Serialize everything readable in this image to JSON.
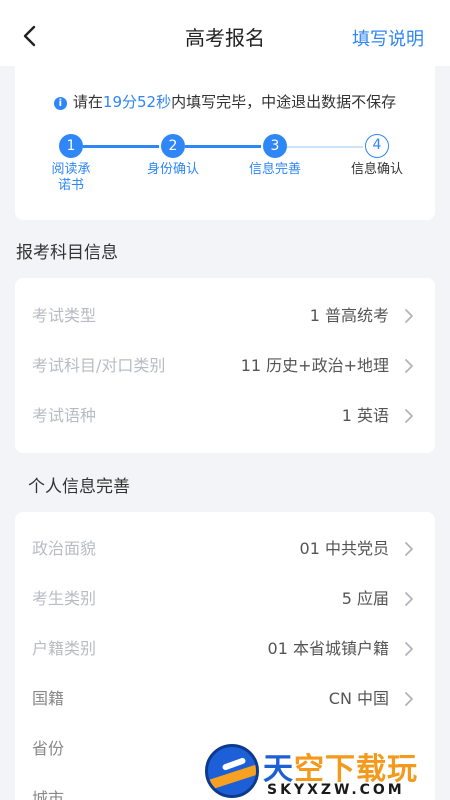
{
  "nav": {
    "back_icon": "chevron-left-icon",
    "title": "高考报名",
    "help_label": "填写说明"
  },
  "notice": {
    "icon": "info-icon",
    "prefix": "请在",
    "time": "19分52秒",
    "suffix": "内填写完毕，中途退出数据不保存"
  },
  "steps": [
    {
      "num": "1",
      "label": "阅读承诺书",
      "state": "done"
    },
    {
      "num": "2",
      "label": "身份确认",
      "state": "done"
    },
    {
      "num": "3",
      "label": "信息完善",
      "state": "current"
    },
    {
      "num": "4",
      "label": "信息确认",
      "state": "pending"
    }
  ],
  "subject_section": {
    "title": "报考科目信息",
    "rows": [
      {
        "label": "考试类型",
        "value": "1 普高统考"
      },
      {
        "label": "考试科目/对口类别",
        "value": "11 历史+政治+地理"
      },
      {
        "label": "考试语种",
        "value": "1 英语"
      }
    ]
  },
  "personal_section": {
    "title": "个人信息完善",
    "rows": [
      {
        "label": "政治面貌",
        "value": "01 中共党员"
      },
      {
        "label": "考生类别",
        "value": "5 应届"
      },
      {
        "label": "户籍类别",
        "value": "01 本省城镇户籍"
      },
      {
        "label": "国籍",
        "value": "CN 中国"
      },
      {
        "label": "省份",
        "value": ""
      },
      {
        "label": "城市",
        "value": ""
      }
    ]
  },
  "watermark": {
    "cn_text_a": "天",
    "cn_text_b": "空",
    "cn_text_c": "下载玩",
    "en_text": "SKYXZW.COM",
    "colors": {
      "primary": "#1d5fd6",
      "accent": "#f39a1d"
    }
  },
  "colors": {
    "accent": "#2f86f6",
    "label_gray": "#b8bcc2",
    "background": "#f2f4f7"
  }
}
